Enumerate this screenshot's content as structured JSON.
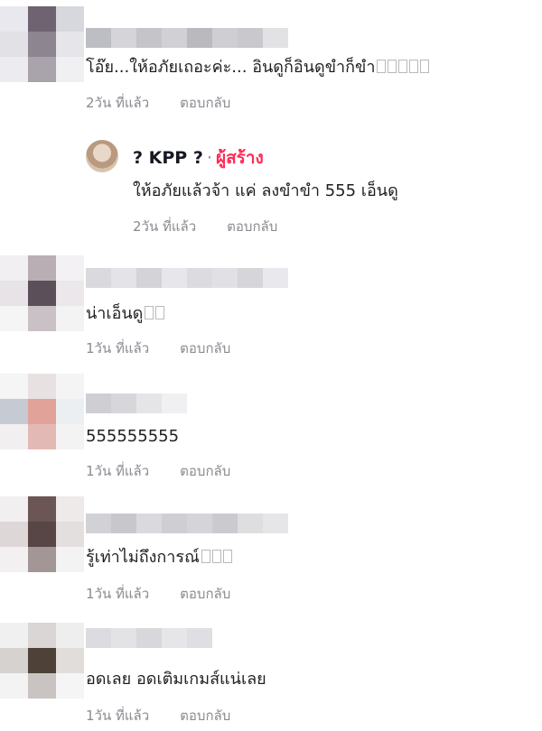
{
  "comments": [
    {
      "text": "โอ๊ย...ให้อภัยเถอะค่ะ... อินดูก็อินดูขำก็ขำ",
      "emoji_count": 5,
      "time": "2วัน ที่แล้ว",
      "reply_label": "ตอบกลับ",
      "avatar_colors": [
        "#e8e8ee",
        "#6f6372",
        "#d7d7de",
        "#e2e1e6",
        "#8d8590",
        "#e6e6ea",
        "#ececf0",
        "#a9a4ab",
        "#f0f0f3"
      ],
      "name_colors": [
        "#bdbdc4",
        "#d4d4d9",
        "#c4c4c9",
        "#d1d1d5",
        "#b9b9be",
        "#cfcfd3",
        "#c8c8cd",
        "#e2e2e5"
      ]
    },
    {
      "text": "น่าเอ็นดู",
      "emoji_count": 2,
      "time": "1วัน ที่แล้ว",
      "reply_label": "ตอบกลับ",
      "avatar_colors": [
        "#f1eff1",
        "#b8aeb4",
        "#f3f1f3",
        "#e8e3e7",
        "#5b4f5a",
        "#ece7ea",
        "#f6f5f6",
        "#c9c1c6",
        "#f4f3f4"
      ],
      "name_colors": [
        "#d9d9de",
        "#e4e4e8",
        "#d3d3d8",
        "#e7e7eb",
        "#dbdbe0",
        "#e1e1e5",
        "#d6d6da",
        "#e9e9ed"
      ]
    },
    {
      "text": "555555555",
      "emoji_count": 0,
      "time": "1วัน ที่แล้ว",
      "reply_label": "ตอบกลับ",
      "avatar_colors": [
        "#f5f5f6",
        "#e7e1e2",
        "#f4f4f5",
        "#c6cad3",
        "#e1a399",
        "#eceff2",
        "#f2eff0",
        "#e3b9b5",
        "#f3f3f4"
      ],
      "name_colors": [
        "#cfcfd3",
        "#d7d7db",
        "#e5e5e8",
        "#f0f0f2"
      ]
    },
    {
      "text": "รู้เท่าไม่ถึงการณ์",
      "emoji_count": 3,
      "time": "1วัน ที่แล้ว",
      "reply_label": "ตอบกลับ",
      "avatar_colors": [
        "#f1efef",
        "#6b5655",
        "#eeeaea",
        "#ddd7d7",
        "#584646",
        "#e4dfdf",
        "#f2f0f0",
        "#a39696",
        "#f4f3f3"
      ],
      "name_colors": [
        "#d2d2d6",
        "#c8c8cc",
        "#dadade",
        "#cfcfd3",
        "#d5d5d9",
        "#cbcbcf",
        "#dedee1",
        "#e6e6e9"
      ]
    },
    {
      "text": "อดเลย อดเติมเกมส์แน่เลย",
      "emoji_count": 0,
      "time": "1วัน ที่แล้ว",
      "reply_label": "ตอบกลับ",
      "avatar_colors": [
        "#f0f0f1",
        "#d9d6d5",
        "#eeeeef",
        "#d6d2d0",
        "#4e4138",
        "#e1dddb",
        "#f3f3f4",
        "#c9c4c1",
        "#f5f5f6"
      ],
      "name_colors": [
        "#dcdce0",
        "#e3e3e6",
        "#d8d8dc",
        "#e6e6e9",
        "#dfdfe3"
      ]
    }
  ],
  "reply": {
    "name": "KPP",
    "name_prefix_glyph": "?",
    "name_suffix_glyph": "?",
    "separator": "·",
    "creator_badge": "ผู้สร้าง",
    "text": "ให้อภัยแล้วจ้า แค่ ลงขำขำ 555 เอ็นดู",
    "time": "2วัน ที่แล้ว",
    "reply_label": "ตอบกลับ"
  },
  "colors": {
    "creator_badge": "#fe2c55",
    "meta": "#8a8b91"
  }
}
